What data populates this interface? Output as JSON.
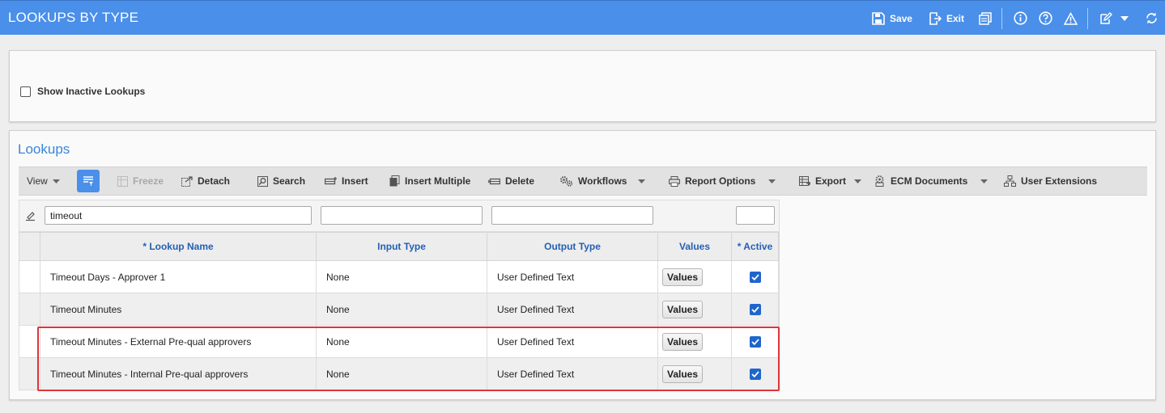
{
  "window": {
    "title": "LOOKUPS BY TYPE"
  },
  "topbar": {
    "save_label": "Save",
    "exit_label": "Exit"
  },
  "filter_panel": {
    "show_inactive_label": "Show Inactive Lookups"
  },
  "lookups": {
    "title": "Lookups",
    "toolbar": {
      "view_label": "View",
      "freeze_label": "Freeze",
      "detach_label": "Detach",
      "search_label": "Search",
      "insert_label": "Insert",
      "insert_multiple_label": "Insert Multiple",
      "delete_label": "Delete",
      "workflows_label": "Workflows",
      "report_options_label": "Report Options",
      "export_label": "Export",
      "ecm_documents_label": "ECM Documents",
      "user_extensions_label": "User Extensions"
    },
    "filters": {
      "lookup_name": "timeout",
      "input_type": "",
      "output_type": "",
      "active": ""
    },
    "columns": {
      "lookup_name": "* Lookup Name",
      "input_type": "Input Type",
      "output_type": "Output Type",
      "values": "Values",
      "active": "* Active"
    },
    "rows": [
      {
        "lookup_name": "Timeout Days - Approver 1",
        "input_type": "None",
        "output_type": "User Defined Text",
        "values_button": "Values",
        "active": true
      },
      {
        "lookup_name": "Timeout Minutes",
        "input_type": "None",
        "output_type": "User Defined Text",
        "values_button": "Values",
        "active": true
      },
      {
        "lookup_name": "Timeout Minutes - External Pre-qual approvers",
        "input_type": "None",
        "output_type": "User Defined Text",
        "values_button": "Values",
        "active": true
      },
      {
        "lookup_name": "Timeout Minutes - Internal Pre-qual approvers",
        "input_type": "None",
        "output_type": "User Defined Text",
        "values_button": "Values",
        "active": true
      }
    ]
  },
  "colors": {
    "titlebar": "#4a8fe9",
    "header_text": "#2560b4",
    "highlight": "#e0343a",
    "checkbox": "#1f66cc"
  }
}
